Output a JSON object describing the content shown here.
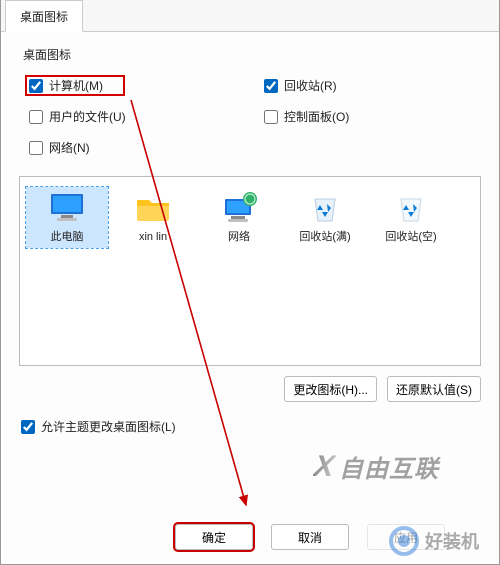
{
  "tab": {
    "label": "桌面图标"
  },
  "group": {
    "label": "桌面图标"
  },
  "checkboxes": {
    "computer": {
      "label": "计算机(M)",
      "checked": true
    },
    "recyclebin": {
      "label": "回收站(R)",
      "checked": true
    },
    "userfiles": {
      "label": "用户的文件(U)",
      "checked": false
    },
    "controlpanel": {
      "label": "控制面板(O)",
      "checked": false
    },
    "network": {
      "label": "网络(N)",
      "checked": false
    }
  },
  "icons": {
    "this_pc": {
      "label": "此电脑"
    },
    "user_folder": {
      "label": "xin lin"
    },
    "network": {
      "label": "网络"
    },
    "recycle_full": {
      "label": "回收站(满)"
    },
    "recycle_empty": {
      "label": "回收站(空)"
    }
  },
  "buttons": {
    "change_icon": "更改图标(H)...",
    "restore_default": "还原默认值(S)",
    "ok": "确定",
    "cancel": "取消",
    "apply": "应用"
  },
  "theme_checkbox": {
    "label": "允许主题更改桌面图标(L)",
    "checked": true
  },
  "watermarks": {
    "wm1": "自由互联",
    "wm2": "好装机"
  }
}
